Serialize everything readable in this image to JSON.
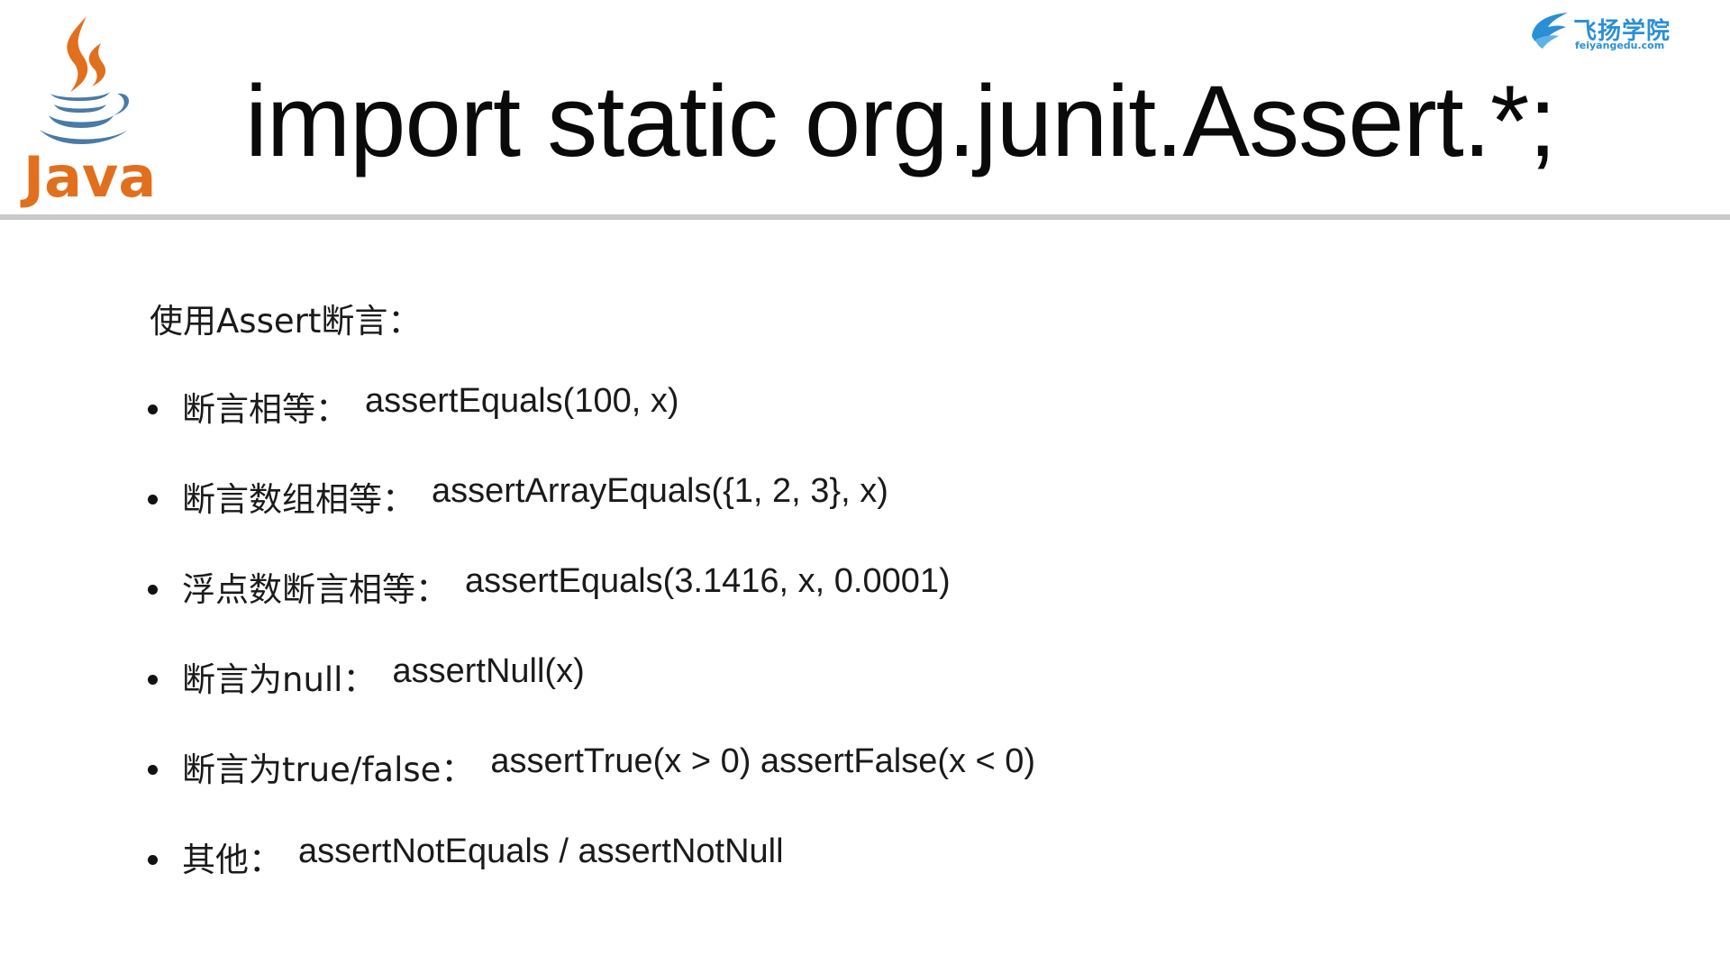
{
  "header": {
    "logo_text": "Java",
    "title": "import static org.junit.Assert.*;",
    "brand": {
      "name": "飞扬学院",
      "url": "feiyangedu.com"
    }
  },
  "content": {
    "intro": "使用Assert断言：",
    "bullets": [
      {
        "label": "断言相等：",
        "code": "assertEquals(100, x)"
      },
      {
        "label": "断言数组相等：",
        "code": "assertArrayEquals({1, 2, 3}, x)"
      },
      {
        "label": "浮点数断言相等：",
        "code": "assertEquals(3.1416, x, 0.0001)"
      },
      {
        "label": "断言为null：",
        "code": "assertNull(x)"
      },
      {
        "label": "断言为true/false：",
        "code": "assertTrue(x > 0)  assertFalse(x < 0)"
      },
      {
        "label": "其他：",
        "code": "assertNotEquals / assertNotNull"
      }
    ]
  },
  "colors": {
    "java_orange": "#e1701e",
    "java_blue": "#4a7aa5",
    "brand_blue": "#2b8fd6",
    "rule_gray": "#c9c9c9"
  }
}
